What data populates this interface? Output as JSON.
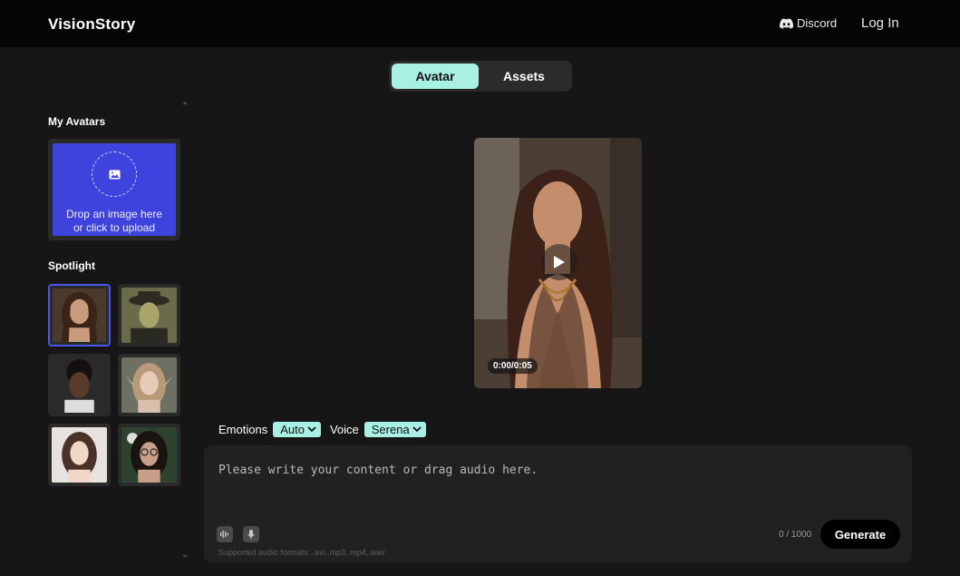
{
  "header": {
    "logo": "VisionStory",
    "discord_label": "Discord",
    "login_label": "Log In"
  },
  "tabs": [
    {
      "label": "Avatar",
      "active": true
    },
    {
      "label": "Assets",
      "active": false
    }
  ],
  "sidebar": {
    "my_avatars_title": "My Avatars",
    "upload_text_line1": "Drop an image here",
    "upload_text_line2": "or click to upload",
    "spotlight_title": "Spotlight",
    "spotlight_avatars": [
      {
        "icon": "avatar-woman-brunette",
        "selected": true
      },
      {
        "icon": "avatar-man-hat",
        "selected": false
      },
      {
        "icon": "avatar-man-curly",
        "selected": false
      },
      {
        "icon": "avatar-elf-woman",
        "selected": false
      },
      {
        "icon": "avatar-woman-asian",
        "selected": false
      },
      {
        "icon": "avatar-woman-glasses",
        "selected": false
      }
    ]
  },
  "preview": {
    "time": "0:00/0:05"
  },
  "options": {
    "emotions_label": "Emotions",
    "emotions_value": "Auto",
    "voice_label": "Voice",
    "voice_value": "Serena"
  },
  "editor": {
    "placeholder": "Please write your content or drag audio here.",
    "char_count": "0 / 1000",
    "supported_formats": "Supported audio formats: .avi,.mp3,.mp4,.wav",
    "generate_label": "Generate"
  },
  "colors": {
    "accent": "#a8f0e4",
    "upload_bg": "#3d43dc",
    "selected_border": "#4a56e8"
  }
}
